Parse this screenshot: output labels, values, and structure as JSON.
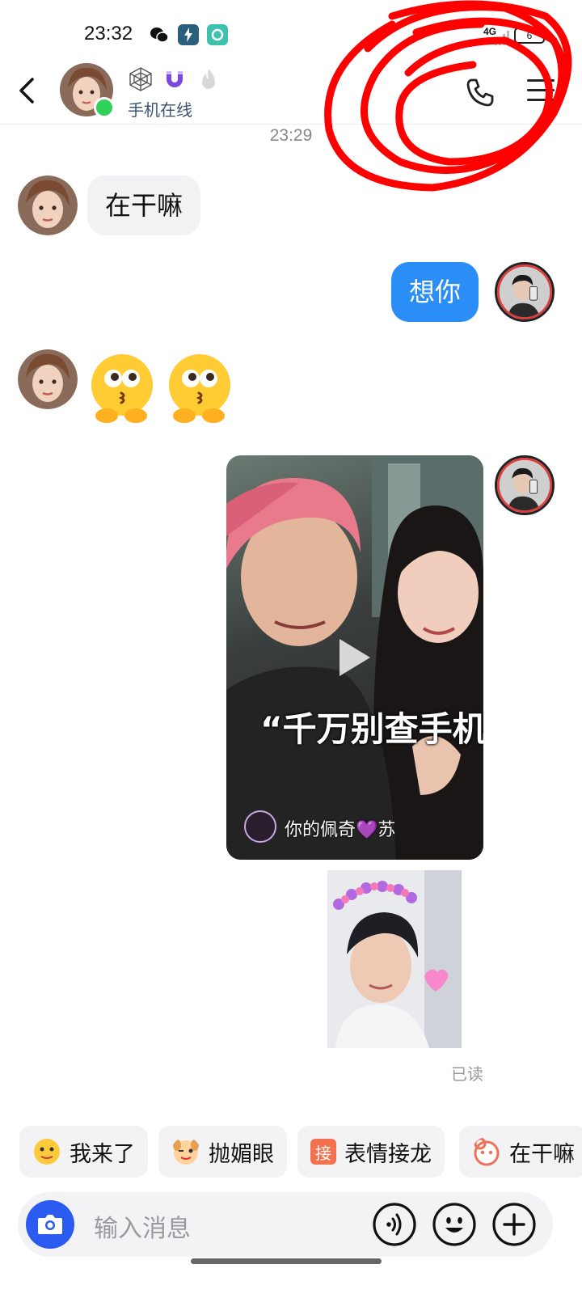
{
  "status_bar": {
    "time": "23:32",
    "network": "4G",
    "battery": "6"
  },
  "header": {
    "status": "手机在线"
  },
  "chat": {
    "timestamp": "23:29",
    "messages": [
      {
        "side": "in",
        "text": "在干嘛"
      },
      {
        "side": "out",
        "text": "想你"
      },
      {
        "side": "in",
        "type": "emoji",
        "emoji_name": "kissing-face-emoji"
      },
      {
        "side": "out",
        "type": "video",
        "caption": "“千万别查手机",
        "author": "你的佩奇💜苏"
      },
      {
        "side": "out",
        "type": "photo"
      }
    ],
    "read_status": "已读"
  },
  "quick_replies": [
    {
      "label": "我来了",
      "icon": "yellow-face-icon"
    },
    {
      "label": "抛媚眼",
      "icon": "wink-dog-icon"
    },
    {
      "label": "表情接龙",
      "icon_text": "接",
      "icon": "jie-tag-icon"
    },
    {
      "label": "在干嘛",
      "icon": "pink-face-icon"
    }
  ],
  "input": {
    "placeholder": "输入消息"
  },
  "colors": {
    "accent": "#2b8ef7",
    "online": "#2fd158",
    "camera": "#2b5bf0",
    "scribble": "#ff0000"
  }
}
